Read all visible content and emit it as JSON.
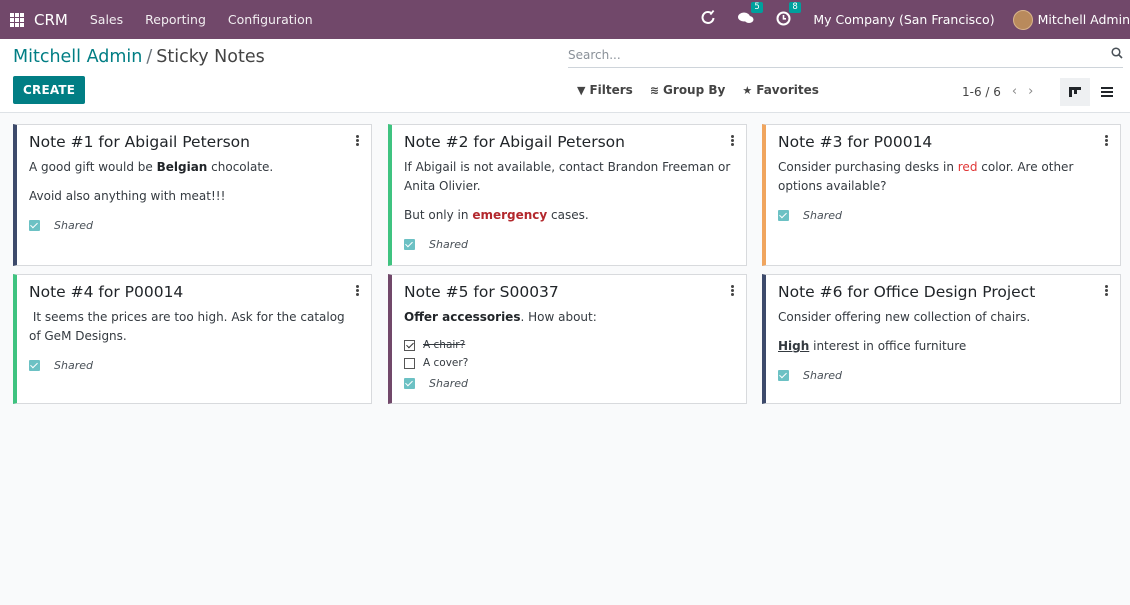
{
  "navbar": {
    "brand": "CRM",
    "menus": [
      "Sales",
      "Reporting",
      "Configuration"
    ],
    "activity_icon": "refresh-icon",
    "messages_count": "5",
    "activities_count": "8",
    "company": "My Company (San Francisco)",
    "user": "Mitchell Admin",
    "color": "#71486a"
  },
  "control": {
    "breadcrumb_parent": "Mitchell Admin",
    "breadcrumb_sep": "/",
    "breadcrumb_current": "Sticky Notes",
    "create_label": "CREATE",
    "search_placeholder": "Search...",
    "filters_label": "Filters",
    "groupby_label": "Group By",
    "favorites_label": "Favorites",
    "pager": "1-6 / 6",
    "accent": "#017e84"
  },
  "notes": [
    {
      "title": "Note #1 for Abigail Peterson",
      "p1_pre": "A good gift would be ",
      "p1_bold": "Belgian",
      "p1_post": " chocolate.",
      "p2": "Avoid also anything with meat!!!",
      "shared": "Shared",
      "color": "#3d4a6b"
    },
    {
      "title": "Note #2 for Abigail Peterson",
      "p1": "If Abigail is not available, contact Brandon Freeman or Anita Olivier.",
      "p2_pre": "But only in ",
      "p2_em": "emergency",
      "p2_post": " cases.",
      "shared": "Shared",
      "color": "#3fc380"
    },
    {
      "title": "Note #3 for P00014",
      "p1_pre": "Consider purchasing desks in ",
      "p1_red": "red",
      "p1_post": " color. Are other options available?",
      "shared": "Shared",
      "color": "#f0a55e"
    },
    {
      "title": "Note #4 for P00014",
      "p1": " It seems the prices are too high. Ask for the catalog of GeM Designs.",
      "shared": "Shared",
      "color": "#3fc380"
    },
    {
      "title": "Note #5 for S00037",
      "p1_bold": "Offer accessories",
      "p1_post": ". How about:",
      "task1": "A chair?",
      "task2": "A cover?",
      "shared": "Shared",
      "color": "#71486a"
    },
    {
      "title": "Note #6 for Office Design Project",
      "p1": "Consider offering new collection of chairs.",
      "p2_under": "High",
      "p2_post": " interest in office furniture",
      "shared": "Shared",
      "color": "#3d4a6b"
    }
  ]
}
